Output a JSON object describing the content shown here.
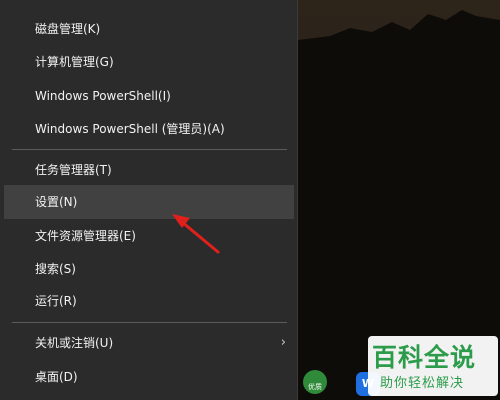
{
  "menu": {
    "items": [
      {
        "label": "磁盘管理(K)"
      },
      {
        "label": "计算机管理(G)"
      },
      {
        "label": "Windows PowerShell(I)"
      },
      {
        "label": "Windows PowerShell (管理员)(A)"
      },
      {
        "label": "任务管理器(T)"
      },
      {
        "label": "设置(N)"
      },
      {
        "label": "文件资源管理器(E)"
      },
      {
        "label": "搜索(S)"
      },
      {
        "label": "运行(R)"
      },
      {
        "label": "关机或注销(U)"
      },
      {
        "label": "桌面(D)"
      }
    ],
    "highlighted_item": "设置(N)",
    "submenu_arrow": "›"
  },
  "taskbar": {
    "green_icon_label": "优质",
    "blue_icon_label": "W"
  },
  "watermark": {
    "title": "百科全说",
    "subtitle": "助你轻松解决"
  },
  "colors": {
    "menu_bg": "#2b2b2b",
    "hover_bg": "#414141",
    "annotation_arrow": "#e0201b",
    "watermark_green": "#2c9c4b"
  }
}
